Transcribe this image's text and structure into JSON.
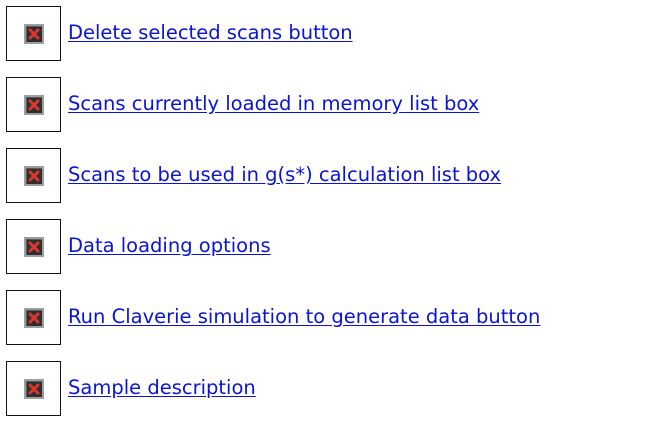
{
  "links": [
    {
      "label": "Delete selected scans button",
      "icon": "broken-image-icon"
    },
    {
      "label": "Scans currently loaded in memory list box",
      "icon": "broken-image-icon"
    },
    {
      "label": "Scans to be used in g(s*) calculation list box",
      "icon": "broken-image-icon"
    },
    {
      "label": "Data loading options",
      "icon": "broken-image-icon"
    },
    {
      "label": "Run Claverie simulation to generate data button",
      "icon": "broken-image-icon"
    },
    {
      "label": "Sample description",
      "icon": "broken-image-icon"
    }
  ],
  "colors": {
    "link": "#0a13d6",
    "icon_border": "#111111",
    "broken_icon_x": "#e0352b"
  }
}
